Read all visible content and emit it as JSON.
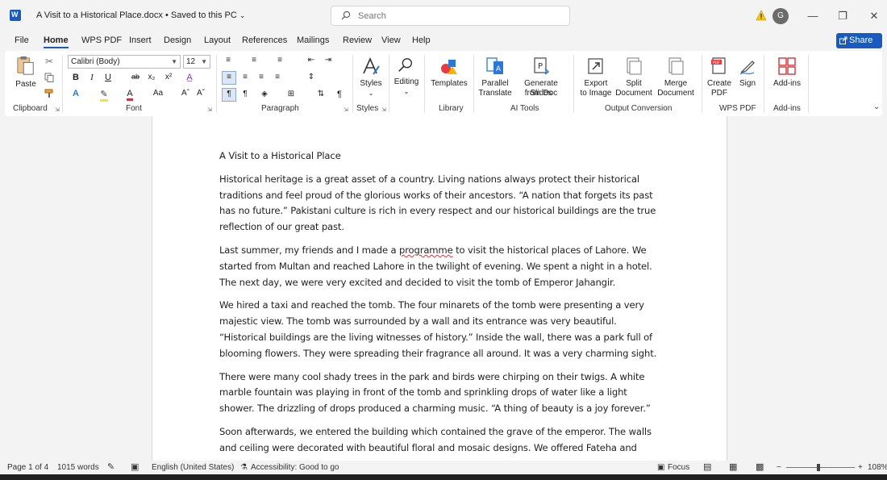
{
  "titlebar": {
    "doc_title": "A Visit to a Historical Place.docx",
    "saved_status": "Saved to this PC",
    "search_placeholder": "Search",
    "avatar_initial": "G"
  },
  "menu": {
    "tabs": [
      "File",
      "Home",
      "WPS PDF",
      "Insert",
      "Design",
      "Layout",
      "References",
      "Mailings",
      "Review",
      "View",
      "Help"
    ],
    "active_tab": "Home",
    "share_label": "Share"
  },
  "ribbon": {
    "paste_label": "Paste",
    "font_name": "Calibri (Body)",
    "font_size": "12",
    "styles_label": "Styles",
    "editing_label": "Editing",
    "templates_label": "Templates",
    "parallel_translate_1": "Parallel",
    "parallel_translate_2": "Translate",
    "generate_slides_1": "Generate Slides",
    "generate_slides_2": "from Doc",
    "export_image_1": "Export",
    "export_image_2": "to Image",
    "split_doc_1": "Split",
    "split_doc_2": "Document",
    "merge_doc_1": "Merge",
    "merge_doc_2": "Document",
    "create_pdf_1": "Create",
    "create_pdf_2": "PDF",
    "sign_label": "Sign",
    "addins_label": "Add-ins",
    "groups": {
      "clipboard": "Clipboard",
      "font": "Font",
      "paragraph": "Paragraph",
      "styles": "Styles",
      "library": "Library",
      "ai_tools": "AI Tools",
      "output_conversion": "Output Conversion",
      "wps_pdf": "WPS PDF",
      "addins": "Add-ins"
    }
  },
  "document": {
    "heading": "A Visit to a Historical Place",
    "p1": "Historical heritage is a great asset of a country. Living nations always protect their historical traditions and feel proud of the glorious works of their ancestors. “A nation that forgets its past has no future.” Pakistani culture is rich in every respect and our historical buildings are the true reflection of our great past.",
    "p2_before": "Last summer, my friends and I made a ",
    "p2_spell": "programme",
    "p2_after": " to visit the historical places of Lahore. We started from Multan and reached Lahore in the twilight of evening. We spent a night in a hotel. The next day, we were very excited and decided to visit the tomb of Emperor Jahangir.",
    "p3": "We hired a taxi and reached the tomb. The four minarets of the tomb were presenting a very majestic view. The tomb was surrounded by a wall and its entrance was very beautiful. “Historical buildings are the living witnesses of history.” Inside the wall, there was a park full of blooming flowers. They were spreading their fragrance all around. It was a very charming sight.",
    "p4": "There were many cool shady trees in the park and birds were chirping on their twigs. A white marble fountain was playing in front of the tomb and sprinkling drops of water like a light shower. The drizzling of drops produced a charming music. “A thing of beauty is a joy forever.”",
    "p5": "Soon afterwards, we entered the building which contained the grave of the emperor. The walls and ceiling were decorated with beautiful floral and mosaic designs. We offered Fateha and"
  },
  "status": {
    "page": "Page 1 of 4",
    "words": "1015 words",
    "language": "English (United States)",
    "accessibility": "Accessibility: Good to go",
    "focus": "Focus",
    "zoom": "108%"
  }
}
